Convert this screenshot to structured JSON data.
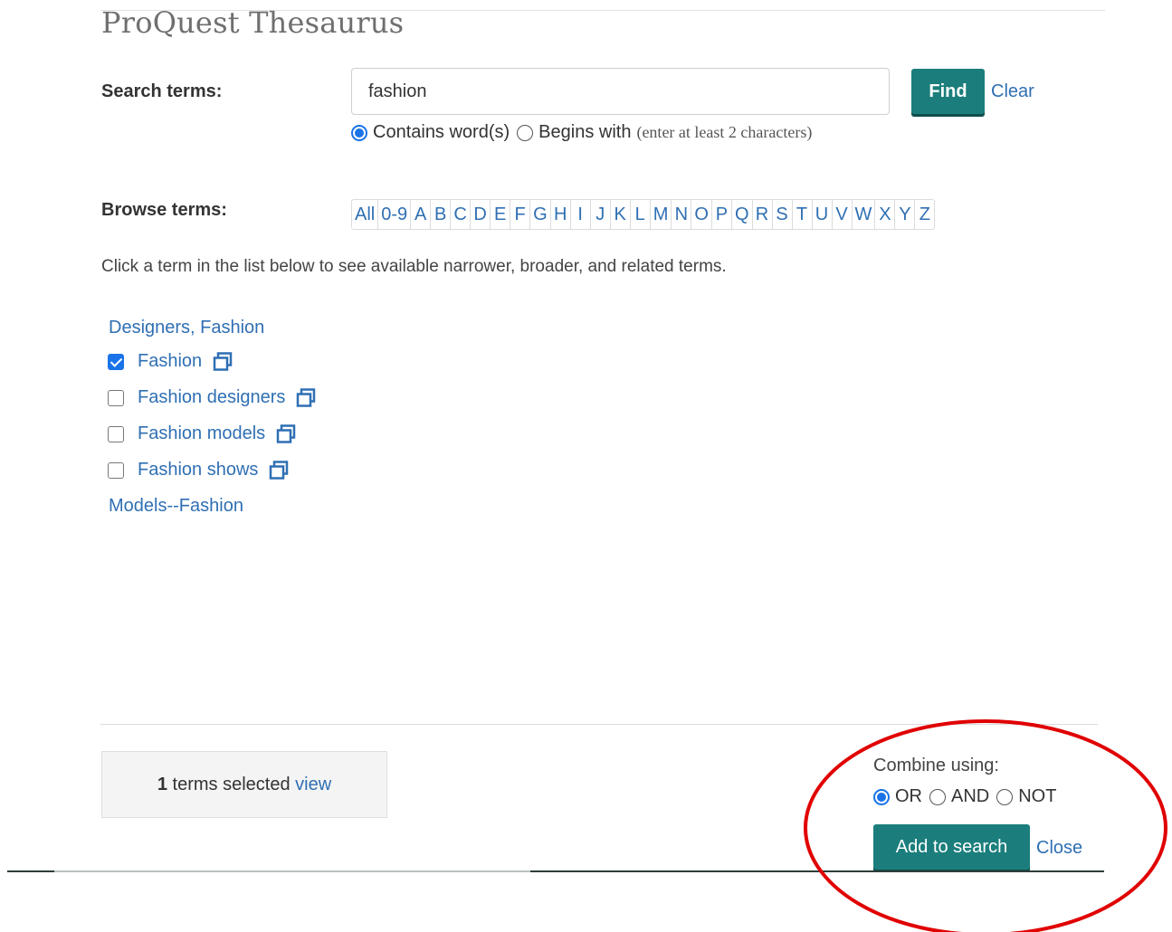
{
  "title": "ProQuest Thesaurus",
  "search": {
    "label": "Search terms:",
    "value": "fashion",
    "find_label": "Find",
    "clear_label": "Clear",
    "mode_contains": "Contains word(s)",
    "mode_begins": "Begins with",
    "hint": "(enter at least 2 characters)",
    "selected_mode": "contains"
  },
  "browse": {
    "label": "Browse terms:",
    "letters": [
      "All",
      "0-9",
      "A",
      "B",
      "C",
      "D",
      "E",
      "F",
      "G",
      "H",
      "I",
      "J",
      "K",
      "L",
      "M",
      "N",
      "O",
      "P",
      "Q",
      "R",
      "S",
      "T",
      "U",
      "V",
      "W",
      "X",
      "Y",
      "Z"
    ]
  },
  "instruction": "Click a term in the list below to see available narrower, broader, and related terms.",
  "terms": {
    "top_link": "Designers, Fashion",
    "items": [
      {
        "label": "Fashion",
        "checked": true
      },
      {
        "label": "Fashion designers",
        "checked": false
      },
      {
        "label": "Fashion models",
        "checked": false
      },
      {
        "label": "Fashion shows",
        "checked": false
      }
    ],
    "bottom_link": "Models--Fashion"
  },
  "footer": {
    "selected_count": "1",
    "selected_text": "terms selected",
    "view_label": "view",
    "combine_label": "Combine using:",
    "op_or": "OR",
    "op_and": "AND",
    "op_not": "NOT",
    "selected_op": "OR",
    "add_label": "Add to search",
    "close_label": "Close"
  },
  "colors": {
    "accent": "#1b7e7c",
    "link": "#2f6fb3",
    "annotation": "#e00000"
  }
}
